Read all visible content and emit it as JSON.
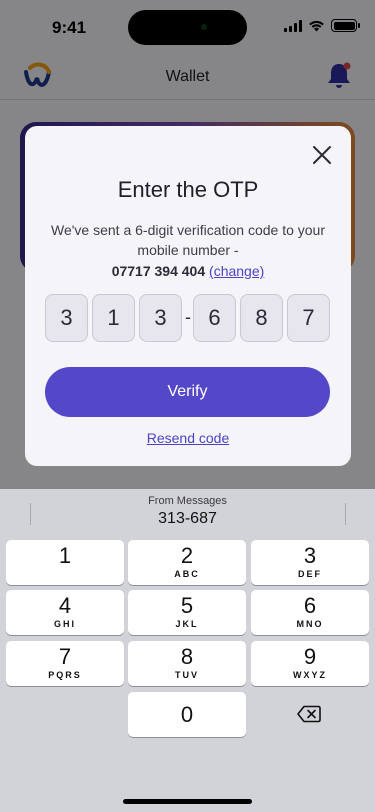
{
  "status_bar": {
    "time": "9:41"
  },
  "header": {
    "title": "Wallet"
  },
  "modal": {
    "title": "Enter the OTP",
    "description": "We've sent a 6-digit verification code to your mobile number -",
    "phone_number": "07717 394 404",
    "change_link": "(change)",
    "otp_digits": [
      "3",
      "1",
      "3",
      "6",
      "8",
      "7"
    ],
    "otp_separator": "-",
    "verify_label": "Verify",
    "resend_label": "Resend code"
  },
  "keyboard": {
    "suggestion_source": "From Messages",
    "suggestion_code": "313-687",
    "keys": [
      {
        "num": "1",
        "letters": ""
      },
      {
        "num": "2",
        "letters": "ABC"
      },
      {
        "num": "3",
        "letters": "DEF"
      },
      {
        "num": "4",
        "letters": "GHI"
      },
      {
        "num": "5",
        "letters": "JKL"
      },
      {
        "num": "6",
        "letters": "MNO"
      },
      {
        "num": "7",
        "letters": "PQRS"
      },
      {
        "num": "8",
        "letters": "TUV"
      },
      {
        "num": "9",
        "letters": "WXYZ"
      },
      {
        "num": "0",
        "letters": ""
      }
    ]
  },
  "colors": {
    "accent": "#5548c8",
    "link": "#4b43c4",
    "modal_bg": "#f5f4f9",
    "keyboard_bg": "#d2d3d8"
  }
}
